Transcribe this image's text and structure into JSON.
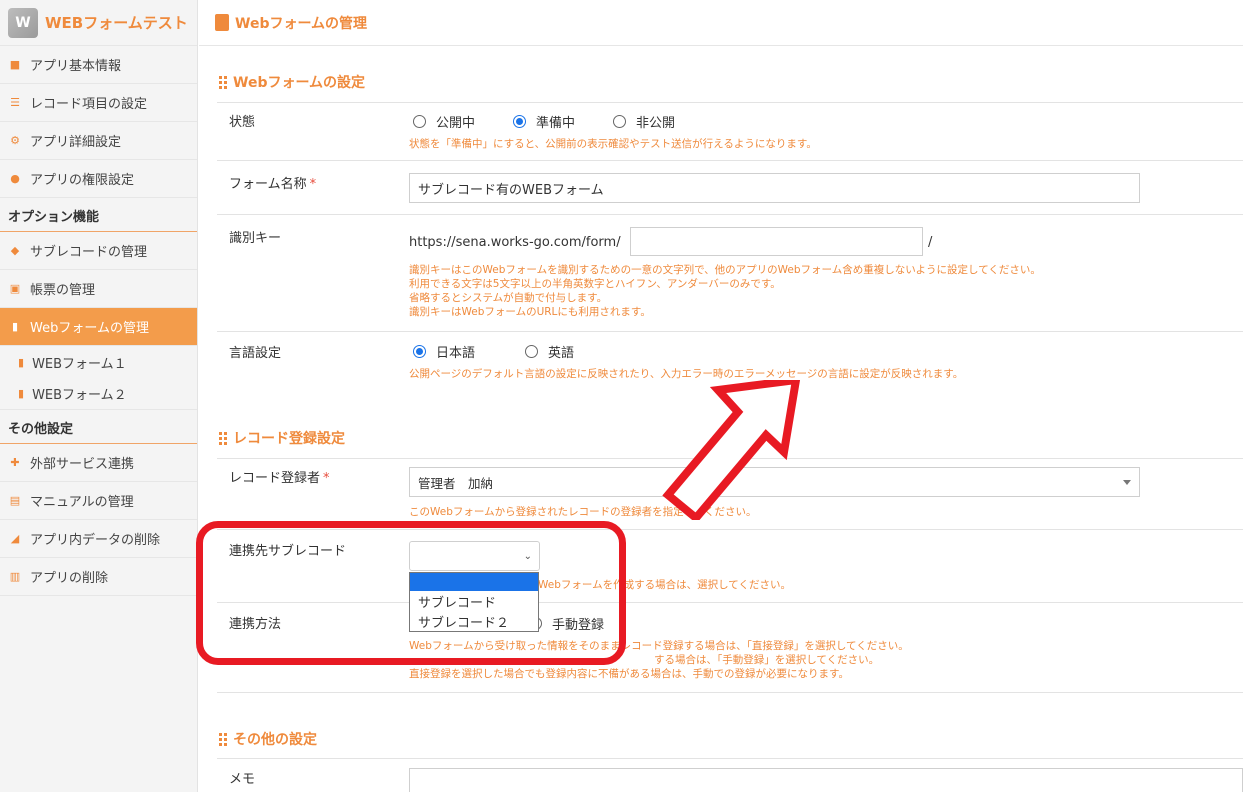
{
  "app": {
    "logo": "W",
    "name": "WEBフォームテスト"
  },
  "sidebar": {
    "items": [
      {
        "label": "アプリ基本情報",
        "icon": "info-icon"
      },
      {
        "label": "レコード項目の設定",
        "icon": "list-icon"
      },
      {
        "label": "アプリ詳細設定",
        "icon": "gear-icon"
      },
      {
        "label": "アプリの権限設定",
        "icon": "users-icon"
      }
    ],
    "option_heading": "オプション機能",
    "option_items": [
      {
        "label": "サブレコードの管理",
        "icon": "layers-icon"
      },
      {
        "label": "帳票の管理",
        "icon": "excel-icon"
      },
      {
        "label": "Webフォームの管理",
        "icon": "clipboard-icon",
        "active": true
      }
    ],
    "sub_items": [
      {
        "label": "WEBフォーム１"
      },
      {
        "label": "WEBフォーム２"
      }
    ],
    "other_heading": "その他設定",
    "other_items": [
      {
        "label": "外部サービス連携",
        "icon": "puzzle-icon"
      },
      {
        "label": "マニュアルの管理",
        "icon": "book-icon"
      },
      {
        "label": "アプリ内データの削除",
        "icon": "eraser-icon"
      },
      {
        "label": "アプリの削除",
        "icon": "trash-icon"
      }
    ]
  },
  "header": {
    "title": "Webフォームの管理"
  },
  "form_settings": {
    "title": "Webフォームの設定",
    "status": {
      "label": "状態",
      "options": [
        "公開中",
        "準備中",
        "非公開"
      ],
      "selected": "準備中",
      "help": "状態を「準備中」にすると、公開前の表示確認やテスト送信が行えるようになります。"
    },
    "form_name": {
      "label": "フォーム名称",
      "required": "*",
      "value": "サブレコード有のWEBフォーム"
    },
    "key": {
      "label": "識別キー",
      "prefix": "https://sena.works-go.com/form/",
      "suffix": "/",
      "value": "",
      "help": [
        "識別キーはこのWebフォームを識別するための一意の文字列で、他のアプリのWebフォーム含め重複しないように設定してください。",
        "利用できる文字は5文字以上の半角英数字とハイフン、アンダーバーのみです。",
        "省略するとシステムが自動で付与します。",
        "識別キーはWebフォームのURLにも利用されます。"
      ]
    },
    "language": {
      "label": "言語設定",
      "options": [
        "日本語",
        "英語"
      ],
      "selected": "日本語",
      "help": "公開ページのデフォルト言語の設定に反映されたり、入力エラー時のエラーメッセージの言語に設定が反映されます。"
    }
  },
  "record_settings": {
    "title": "レコード登録設定",
    "registrant": {
      "label": "レコード登録者",
      "required": "*",
      "value": "管理者　加納",
      "help": "このWebフォームから登録されたレコードの登録者を指定してください。"
    },
    "subrecord": {
      "label": "連携先サブレコード",
      "value": "",
      "options": [
        "",
        "サブレコード",
        "サブレコード２"
      ],
      "help_visible": "Webフォームを作成する場合は、選択してください。"
    },
    "method": {
      "label": "連携方法",
      "visible_option": "手動登録",
      "help": [
        "Webフォームから受け取った情報をそのままレコード登録する場合は、「直接登録」を選択してください。",
        "する場合は、「手動登録」を選択してください。",
        "直接登録を選択した場合でも登録内容に不備がある場合は、手動での登録が必要になります。"
      ]
    }
  },
  "other_settings": {
    "title": "その他の設定",
    "memo": {
      "label": "メモ",
      "value": ""
    }
  },
  "annotation": {
    "box_color": "#e81a23"
  }
}
